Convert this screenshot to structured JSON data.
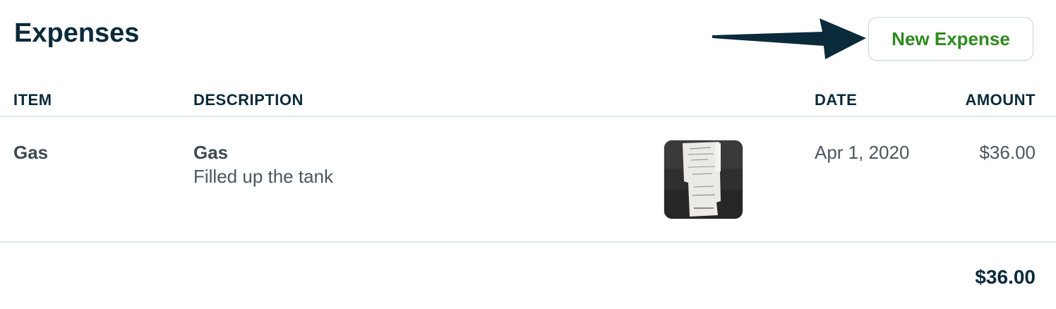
{
  "page": {
    "title": "Expenses",
    "new_expense_label": "New Expense"
  },
  "table": {
    "headers": {
      "item": "ITEM",
      "description": "DESCRIPTION",
      "date": "DATE",
      "amount": "AMOUNT"
    },
    "rows": [
      {
        "item": "Gas",
        "description_title": "Gas",
        "description_text": "Filled up the tank",
        "receipt_icon": "receipt-photo-icon",
        "date": "Apr 1, 2020",
        "amount": "$36.00"
      }
    ],
    "total": "$36.00"
  },
  "colors": {
    "heading": "#0b2a3a",
    "button_text": "#2e8a1f",
    "body_text": "#4a565d",
    "arrow": "#0b2a3a"
  }
}
